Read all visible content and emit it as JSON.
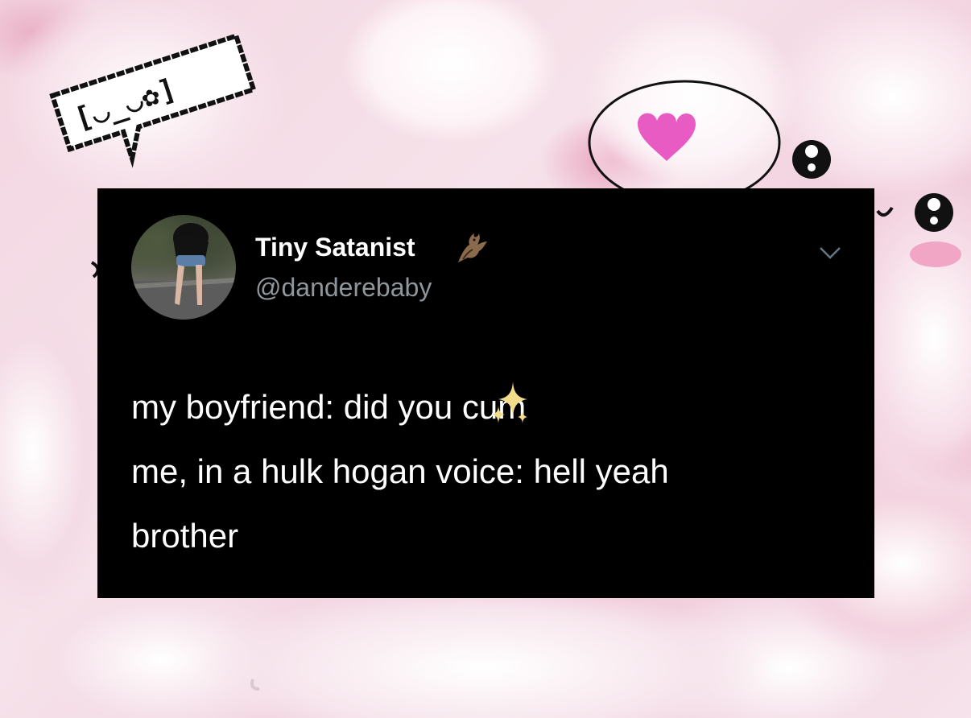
{
  "tweet": {
    "display_name": "Tiny Satanist",
    "handle": "@danderebaby",
    "name_emoji_icon": "bat-icon",
    "menu_icon": "chevron-down-icon",
    "lines": [
      "my boyfriend: did you cum",
      "me, in a hulk hogan voice: hell yeah",
      "brother"
    ],
    "inline_emoji_icon": "sparkles-icon"
  },
  "decorations": {
    "speech_bubble_icon": "kaomoji-speech-bubble-icon",
    "heart_icon": "heart-icon",
    "eye_icon": "cartoon-eye-icon"
  },
  "colors": {
    "card_background": "#000000",
    "text_primary": "#ffffff",
    "text_secondary": "#8f969c",
    "heart_pink": "#e85bc3",
    "sparkle_gold": "#f3dc8a"
  }
}
